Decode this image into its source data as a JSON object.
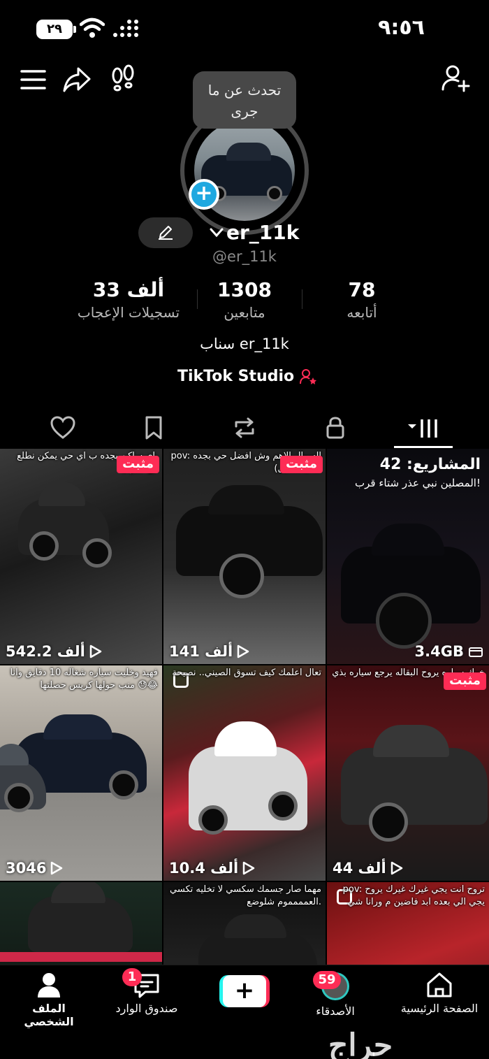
{
  "status_bar": {
    "battery": "٢٩",
    "time": "٩:٥٦"
  },
  "profile": {
    "tooltip": "تحدث عن ما جرى",
    "display_name": "er_11k",
    "handle": "@er_11k",
    "stats": {
      "likes": {
        "value": "33 ألف",
        "label": "تسجيلات الإعجاب"
      },
      "followers": {
        "value": "1308",
        "label": "متابعين"
      },
      "following": {
        "value": "78",
        "label": "أتابعه"
      }
    },
    "bio": "سناب er_11k",
    "studio_link": "TikTok Studio"
  },
  "videos": [
    {
      "caption": "ياي ساكن بجده ب اي حي يمكن نطلع جيران 🥱",
      "pinned": "مثبت",
      "views": "542.2 ألف"
    },
    {
      "caption": "pov: السوال الاهم وش افضل حي بجده (استنابل) 😏",
      "pinned": "مثبت",
      "views": "141 ألف"
    },
    {
      "drafts_title": "المشاريع: 42",
      "caption": "المصلين نبي عذر شتاء قرب!",
      "size": "3.4GB"
    },
    {
      "caption": "فهيد وخليت سياره شغاله 10 دقايق وانا منب حولها كريس حصلتها 😓😂",
      "views": "3046"
    },
    {
      "caption": "تعال اعلمك كيف تسوق الصيني.. نصيحة",
      "views": "10.4 ألف"
    },
    {
      "caption": "خوك سياره يروح البقاله يرجع سياره بذي الحاله..",
      "pinned": "مثبت",
      "views": "44 ألف"
    },
    {
      "caption": ""
    },
    {
      "caption": "مهما صار جسمك سكسي لا تخليه تكسي العمممموم شلوضع."
    },
    {
      "caption": "pov: تروح انت يجي غيرك غيرك يروح يجي الي بعده ابد فاضين م ورانا شي"
    }
  ],
  "nav": {
    "home": "الصفحة الرئيسية",
    "friends": "الأصدقاء",
    "friends_badge": "59",
    "inbox": "صندوق الوارد",
    "inbox_badge": "1",
    "profile": "الملف الشخصي"
  },
  "watermark": "حراج"
}
